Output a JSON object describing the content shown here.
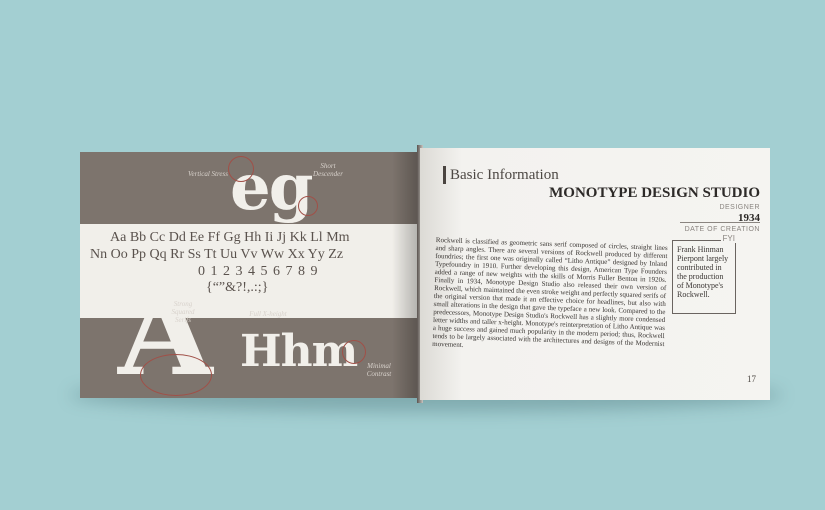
{
  "left_page": {
    "specimen_glyphs": "eg",
    "annotations": {
      "vertical_stress": "Vertical Stress",
      "short_descender": "Short Descender",
      "strong_serifs": "Strong Squared Serifs",
      "full_x_height": "Full X-height",
      "minimal_contrast": "Minimal Contrast"
    },
    "alphabet_line1": "Aa Bb Cc Dd Ee Ff Gg Hh Ii Jj Kk Ll Mm",
    "alphabet_line2": "Nn Oo Pp Qq Rr Ss Tt Uu Vv Ww Xx Yy Zz",
    "digits": "0 1 2 3 4 5 6 7 8 9",
    "punctuation": "{“”&?!,.:;}",
    "big_letter": "A",
    "hhm": "Hhm"
  },
  "right_page": {
    "heading": "Basic Information",
    "designer": "MONOTYPE DESIGN STUDIO",
    "designer_label": "DESIGNER",
    "year": "1934",
    "date_label": "DATE OF CREATION",
    "body": "Rockwell is classified as geometric sans serif composed of circles, straight lines and sharp angles. There are several versions of Rockwell produced by different foundries; the first one was originally called “Litho Antique” designed by Inland Typefoundry in 1910. Further developing this design, American Type Founders added a range of new weights with the skills of Morris Fuller Benton in 1920s. Finally in 1934, Monotype Design Studio also released their own version of Rockwell, which maintained the even stroke weight and perfectly squared serifs of the original version that made it an effective choice for headlines, but also with small alterations in the design that gave the typeface a new look. Compared to the predecessors, Monotype Design Studio's Rockwell has a slightly more condensed letter widths and taller x-height. Monotype's reinterpretation of Litho Antique was a huge success and gained much popularity in the modern period; thus, Rockwell tends to be largely associated with the architectures and designs of the Modernist movement.",
    "fyi_tag": "FYI",
    "fyi_text": "Frank Hinman Pierpont largely contributed in the production of Monotype's Rockwell.",
    "page_number": "17"
  },
  "colors": {
    "background": "#a3cfd2",
    "left_page_taupe": "#7d746d",
    "band": "#f1efea",
    "annotation_red": "#a05048"
  }
}
